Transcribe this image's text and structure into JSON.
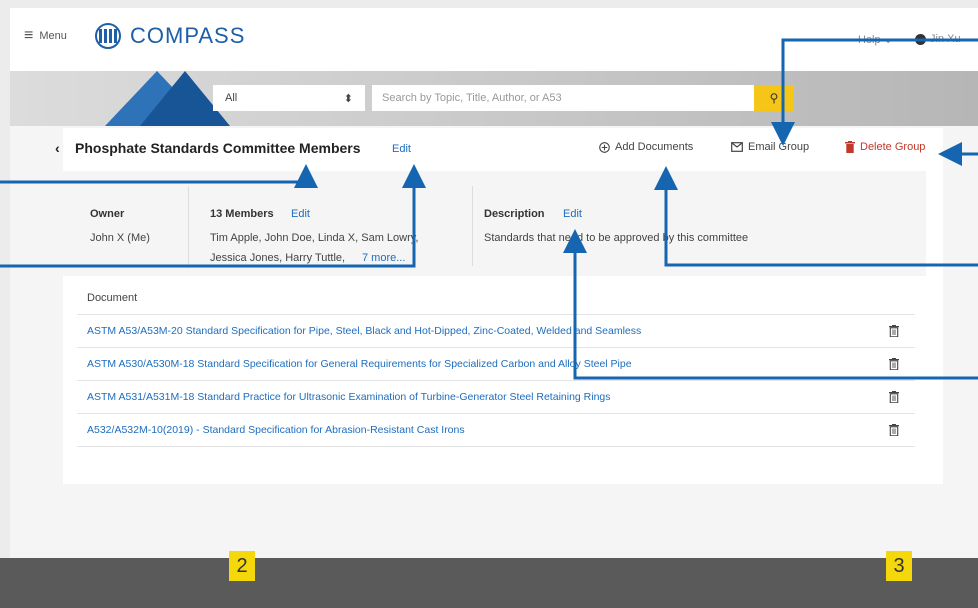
{
  "header": {
    "menu_label": "Menu",
    "logo_text": "COMPASS",
    "help_label": "Help",
    "user_name": "Jin Xu"
  },
  "search": {
    "scope_value": "All",
    "placeholder": "Search by Topic, Title, Author, or A53"
  },
  "group": {
    "title": "Phosphate Standards Committee Members",
    "edit_label": "Edit",
    "actions": {
      "add_documents": "Add Documents",
      "email_group": "Email Group",
      "delete_group": "Delete Group"
    }
  },
  "info": {
    "owner_label": "Owner",
    "owner_value": "John X (Me)",
    "members_label": "13 Members",
    "members_edit": "Edit",
    "members_line1": "Tim Apple, John Doe, Linda X, Sam Lowry,",
    "members_line2": "Jessica Jones, Harry Tuttle,",
    "members_more": "7 more...",
    "description_label": "Description",
    "description_edit": "Edit",
    "description_value": "Standards that need to be approved by this committee"
  },
  "table": {
    "header": "Document",
    "rows": [
      "ASTM A53/A53M-20 Standard Specification for Pipe, Steel, Black and Hot-Dipped, Zinc-Coated, Welded and Seamless",
      "ASTM A530/A530M-18 Standard Specification for General Requirements for Specialized Carbon and Alloy Steel Pipe",
      "ASTM A531/A531M-18 Standard Practice for Ultrasonic Examination of Turbine-Generator Steel Retaining Rings",
      "A532/A532M-10(2019) - Standard Specification for Abrasion-Resistant Cast Irons"
    ]
  },
  "badges": [
    "2",
    "3"
  ],
  "colors": {
    "accent": "#1d6dbf",
    "delete": "#c0392b",
    "search_button": "#f5c518",
    "callout": "#1565b0",
    "badge": "#f5d80c"
  }
}
